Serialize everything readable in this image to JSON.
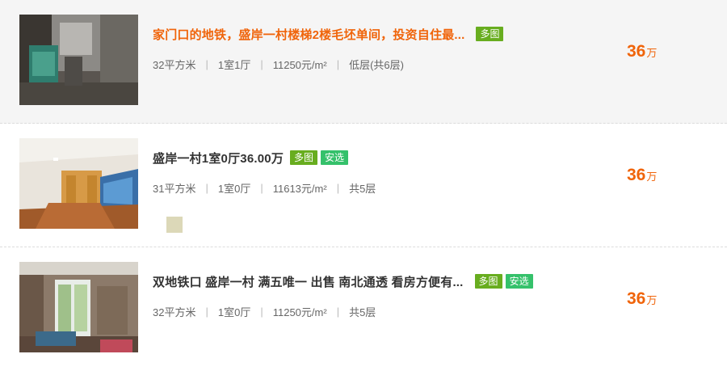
{
  "listings": [
    {
      "title": "家门口的地铁，盛岸一村楼梯2楼毛坯单间，投资自住最...",
      "badges": [
        "多图"
      ],
      "area": "32平方米",
      "layout": "1室1厅",
      "unit_price": "11250元/m²",
      "floor": "低层(共6层)",
      "price_value": "36",
      "price_unit": "万"
    },
    {
      "title": "盛岸一村1室0厅36.00万",
      "badges": [
        "多图",
        "安选"
      ],
      "area": "31平方米",
      "layout": "1室0厅",
      "unit_price": "11613元/m²",
      "floor": "共5层",
      "price_value": "36",
      "price_unit": "万"
    },
    {
      "title": "双地铁口 盛岸一村 满五唯一 出售 南北通透 看房方便有...",
      "badges": [
        "多图",
        "安选"
      ],
      "area": "32平方米",
      "layout": "1室0厅",
      "unit_price": "11250元/m²",
      "floor": "共5层",
      "price_value": "36",
      "price_unit": "万"
    }
  ],
  "colors": {
    "accent_orange": "#f0640a",
    "badge_duotu": "#68ad1f",
    "badge_anxuan": "#35c16b"
  }
}
